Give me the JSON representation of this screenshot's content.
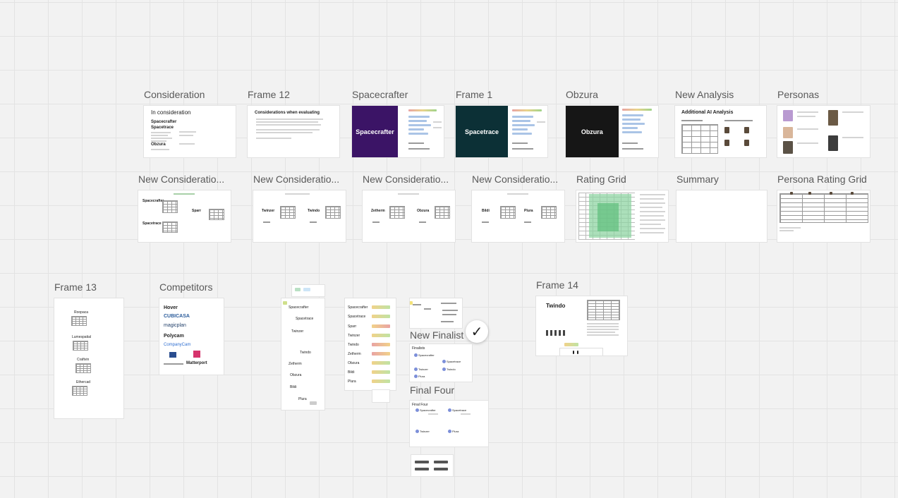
{
  "frames": {
    "consideration": {
      "label": "Consideration",
      "title": "In consideration",
      "items": [
        "Spacecrafter",
        "Spacetrace",
        "Obzura"
      ]
    },
    "frame12": {
      "label": "Frame 12",
      "title": "Considerations when evaluating"
    },
    "spacecrafter": {
      "label": "Spacecrafter",
      "hero": "Spacecrafter",
      "color": "#3b1466"
    },
    "frame1": {
      "label": "Frame 1",
      "hero": "Spacetrace",
      "color": "#0c3036"
    },
    "obzura": {
      "label": "Obzura",
      "hero": "Obzura",
      "color": "#161616"
    },
    "new_analysis": {
      "label": "New Analysis",
      "title": "Additional AI Analysis"
    },
    "personas": {
      "label": "Personas"
    },
    "nc1": {
      "label": "New Consideratio...",
      "left": "Spacecrafter",
      "left2": "Spacetrace",
      "right": "Sparr"
    },
    "nc2": {
      "label": "New Consideratio...",
      "left": "Twinzer",
      "right": "Twindo"
    },
    "nc3": {
      "label": "New Consideratio...",
      "left": "Zetherm",
      "right": "Obzura"
    },
    "nc4": {
      "label": "New Consideratio...",
      "left": "Bildi",
      "right": "Plura"
    },
    "rating_grid": {
      "label": "Rating Grid"
    },
    "summary": {
      "label": "Summary"
    },
    "persona_rating_grid": {
      "label": "Persona Rating Grid"
    },
    "frame13": {
      "label": "Frame 13",
      "items": [
        "Roopaca",
        "Lumespatial",
        "Craftvin",
        "Ethercad"
      ]
    },
    "competitors": {
      "label": "Competitors",
      "logos": [
        "Hover",
        "CUBICASA",
        "magicplan",
        "Polycam",
        "CompanyCam",
        "Matterport"
      ]
    },
    "new_finalist": {
      "label": "New Finalist",
      "title": "Finalists",
      "items": [
        "Spacecrafter",
        "Spacetrace",
        "Twinzer",
        "Twindo",
        "Plura"
      ]
    },
    "final_four": {
      "label": "Final Four",
      "title": "Final Four",
      "items": [
        "Spacecrafter",
        "Spacetrace",
        "Twinzer",
        "Plura"
      ]
    },
    "frame14": {
      "label": "Frame 14",
      "title": "Twindo"
    }
  },
  "loose": {
    "left_list": [
      "Spacecrafter",
      "Spacetrace",
      "Twinzer",
      "Twindo",
      "Zetherm",
      "Obzura",
      "Bildi",
      "Plura"
    ],
    "score_list": [
      "Spacecrafter",
      "Spacetrace",
      "Sparr",
      "Twinzer",
      "Twindo",
      "Zetherm",
      "Obzura",
      "Bildi",
      "Plura"
    ]
  }
}
